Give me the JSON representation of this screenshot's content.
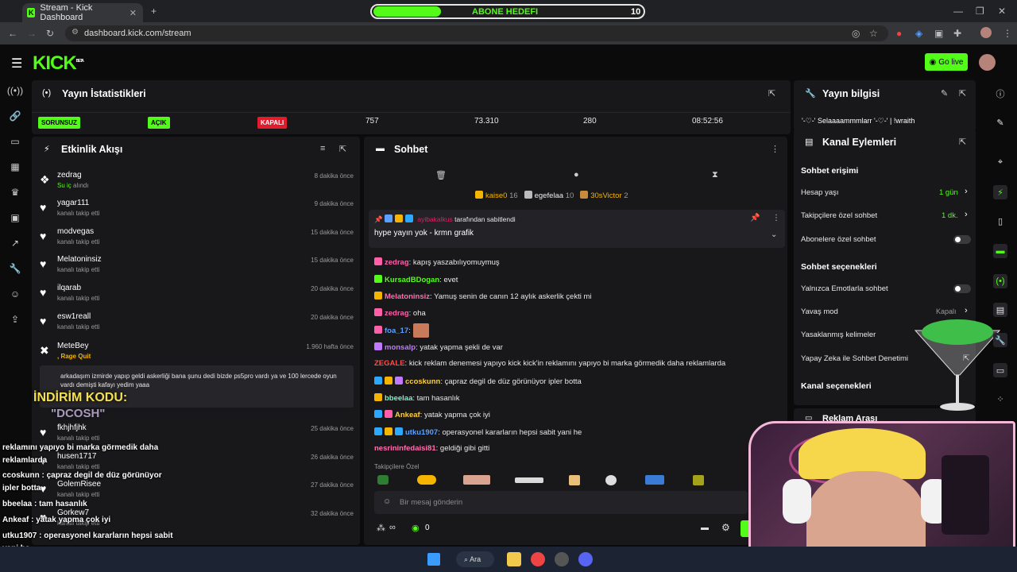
{
  "browser": {
    "tab_title": "Stream - Kick Dashboard",
    "url": "dashboard.kick.com/stream",
    "new_tab": "+"
  },
  "goal_bar": {
    "label": "ABONE HEDEFI",
    "count": "10",
    "progress": 0.25
  },
  "header": {
    "logo": "KICK",
    "logo_sup": "BETA",
    "go_live": "Go live"
  },
  "stats": {
    "title": "Yayın İstatistikleri",
    "badges": [
      "SORUNSUZ",
      "AÇIK",
      "KAPALI"
    ],
    "values": [
      "757",
      "73.310",
      "280",
      "08:52:56"
    ]
  },
  "activity": {
    "title": "Etkinlik Akışı",
    "items": [
      {
        "name": "zedrag",
        "sub_prefix": "Su iç",
        "sub": "alındı",
        "time": "8 dakika önce"
      },
      {
        "name": "yagar111",
        "sub": "kanalı takip etti",
        "time": "9 dakika önce"
      },
      {
        "name": "modvegas",
        "sub": "kanalı takip etti",
        "time": "15 dakika önce"
      },
      {
        "name": "Melatoninsiz",
        "sub": "kanalı takip etti",
        "time": "15 dakika önce"
      },
      {
        "name": "ilqarab",
        "sub": "kanalı takip etti",
        "time": "20 dakika önce"
      },
      {
        "name": "esw1reall",
        "sub": "kanalı takip etti",
        "time": "20 dakika önce"
      },
      {
        "name": "MeteBey",
        "sub": ", Rage Quit",
        "time": "1.960 hafta önce",
        "message": "arkadaşım izmirde yapıp geldi askerliği bana şunu dedi bizde ps5pro vardı ya ve 100 lercede oyun vardı demişti kafayı yedim yaaa"
      },
      {
        "name": "fkhjhfjhk",
        "sub": "kanalı takip etti",
        "time": "25 dakika önce"
      },
      {
        "name": "husen1717",
        "sub": "kanalı takip etti",
        "time": "26 dakika önce"
      },
      {
        "name": "GolemRisee",
        "sub": "kanalı takip etti",
        "time": "27 dakika önce"
      },
      {
        "name": "Gorkew7",
        "sub": "kanalı takip etti",
        "time": "32 dakika önce"
      }
    ]
  },
  "chat": {
    "title": "Sohbet",
    "top_gifters": [
      {
        "name": "kaise0",
        "count": "16"
      },
      {
        "name": "egefelaa",
        "count": "10"
      },
      {
        "name": "30sVictor",
        "count": "2"
      }
    ],
    "pinned": {
      "by": "ayibakalkus",
      "by_suffix": "tarafından sabitlendi",
      "text": "hype yayın yok - krmn grafik"
    },
    "messages": [
      {
        "user": "zedrag",
        "color": "#ff5fa8",
        "text": "kapış yaszabılıyomuymuş"
      },
      {
        "user": "KursadBDogan",
        "color": "#53fc18",
        "text": "evet"
      },
      {
        "user": "Melatoninsiz",
        "color": "#ff6fae",
        "text": "Yamuş senin de canın 12 aylık askerlik çekti mi"
      },
      {
        "user": "zedrag",
        "color": "#ff5fa8",
        "text": "oha"
      },
      {
        "user": "foa_17",
        "color": "#5aa0ff",
        "text": ""
      },
      {
        "user": "monsalp",
        "color": "#c17aff",
        "text": "yatak yapma şekli de var"
      },
      {
        "user": "ZEGALE",
        "color": "#ff4b4b",
        "text": "kick reklam denemesi yapıyo kick kick'in reklamını yapıyo bi marka görmedik daha reklamlarda"
      },
      {
        "user": "ccoskunn",
        "color": "#ffcf3d",
        "text": "çapraz degil de düz görünüyor ipler botta"
      },
      {
        "user": "bbeelaa",
        "color": "#7df2c2",
        "text": "tam hasanlık"
      },
      {
        "user": "Ankeaf",
        "color": "#ffcf3d",
        "text": "yatak yapma çok iyi"
      },
      {
        "user": "utku1907",
        "color": "#5aa0ff",
        "text": "operasyonel kararların hepsi sabit yani he"
      },
      {
        "user": "nesrininfedaisi81",
        "color": "#ff6fae",
        "text": "geldiği gibi gitti"
      }
    ],
    "follower_only": "Takipçilere Özel",
    "input_placeholder": "Bir mesaj gönderin",
    "points": "0"
  },
  "stream_info": {
    "title": "Yayın bilgisi",
    "text": "'-♡-' Selaaaammmlarr '-♡-' | !wraith"
  },
  "channel_actions": {
    "title": "Kanal Eylemleri",
    "chat_access": "Sohbet erişimi",
    "rows": [
      {
        "label": "Hesap yaşı",
        "value": "1 gün"
      },
      {
        "label": "Takipçilere özel sohbet",
        "value": "1 dk."
      },
      {
        "label": "Abonelere özel sohbet",
        "value": ""
      }
    ],
    "chat_options": "Sohbet seçenekleri",
    "rows2": [
      {
        "label": "Yalnızca Emotlarla sohbet",
        "value": ""
      },
      {
        "label": "Yavaş mod",
        "value": "Kapalı"
      },
      {
        "label": "Yasaklanmış kelimeler",
        "value": ""
      },
      {
        "label": "Yapay Zeka ile Sohbet Denetimi",
        "value": ""
      }
    ],
    "channel_options": "Kanal seçenekleri",
    "ad_break": "Reklam Arası"
  },
  "overlay": {
    "discount_title": "İNDİRİM KODU:",
    "discount_code": "\"DCOSH\"",
    "lines": [
      "reklamını yapıyo bi marka görmedik daha",
      "reklamlarda",
      "ccoskunn : çapraz degil de düz görünüyor",
      "ipler botta",
      "bbeelaa : tam hasanlık",
      "Ankeaf : yatak yapma çok iyi",
      "utku1907 : operasyonel kararların hepsi sabit",
      "yani he",
      "nesrininfedaisi81 : geldiği gibi gitti"
    ]
  },
  "taskbar": {
    "search": "Ara"
  }
}
